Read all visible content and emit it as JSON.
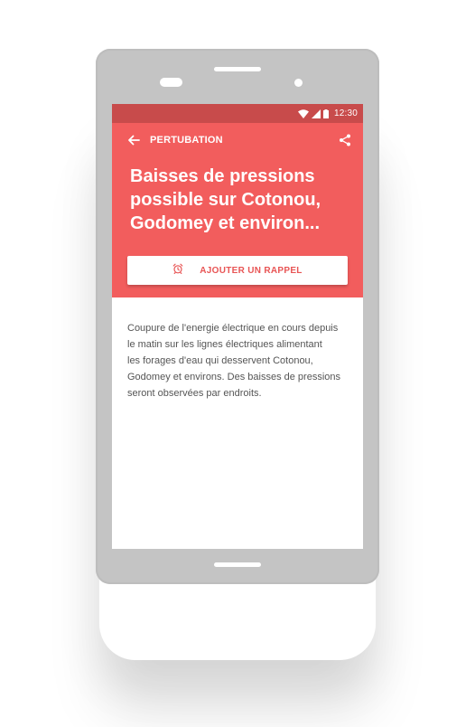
{
  "status_bar": {
    "time": "12:30"
  },
  "app_bar": {
    "title": "PERTUBATION",
    "back_icon": "arrow-back-icon",
    "share_icon": "share-icon"
  },
  "article": {
    "headline": "Baisses de pressions possible sur Cotonou, Godomey et environ...",
    "body": "Coupure de l'energie électrique en cours depuis\nle matin sur les lignes électriques  alimentant\nles forages d'eau qui desservent Cotonou,\nGodomey et environs. Des baisses de pressions\nseront observées par endroits."
  },
  "reminder_button": {
    "label": "AJOUTER UN RAPPEL",
    "icon": "alarm-clock-icon"
  },
  "colors": {
    "header": "#f25d5d",
    "status_bar": "#c84b4b",
    "accent_text": "#e85555",
    "device_frame": "#c4c4c4"
  }
}
